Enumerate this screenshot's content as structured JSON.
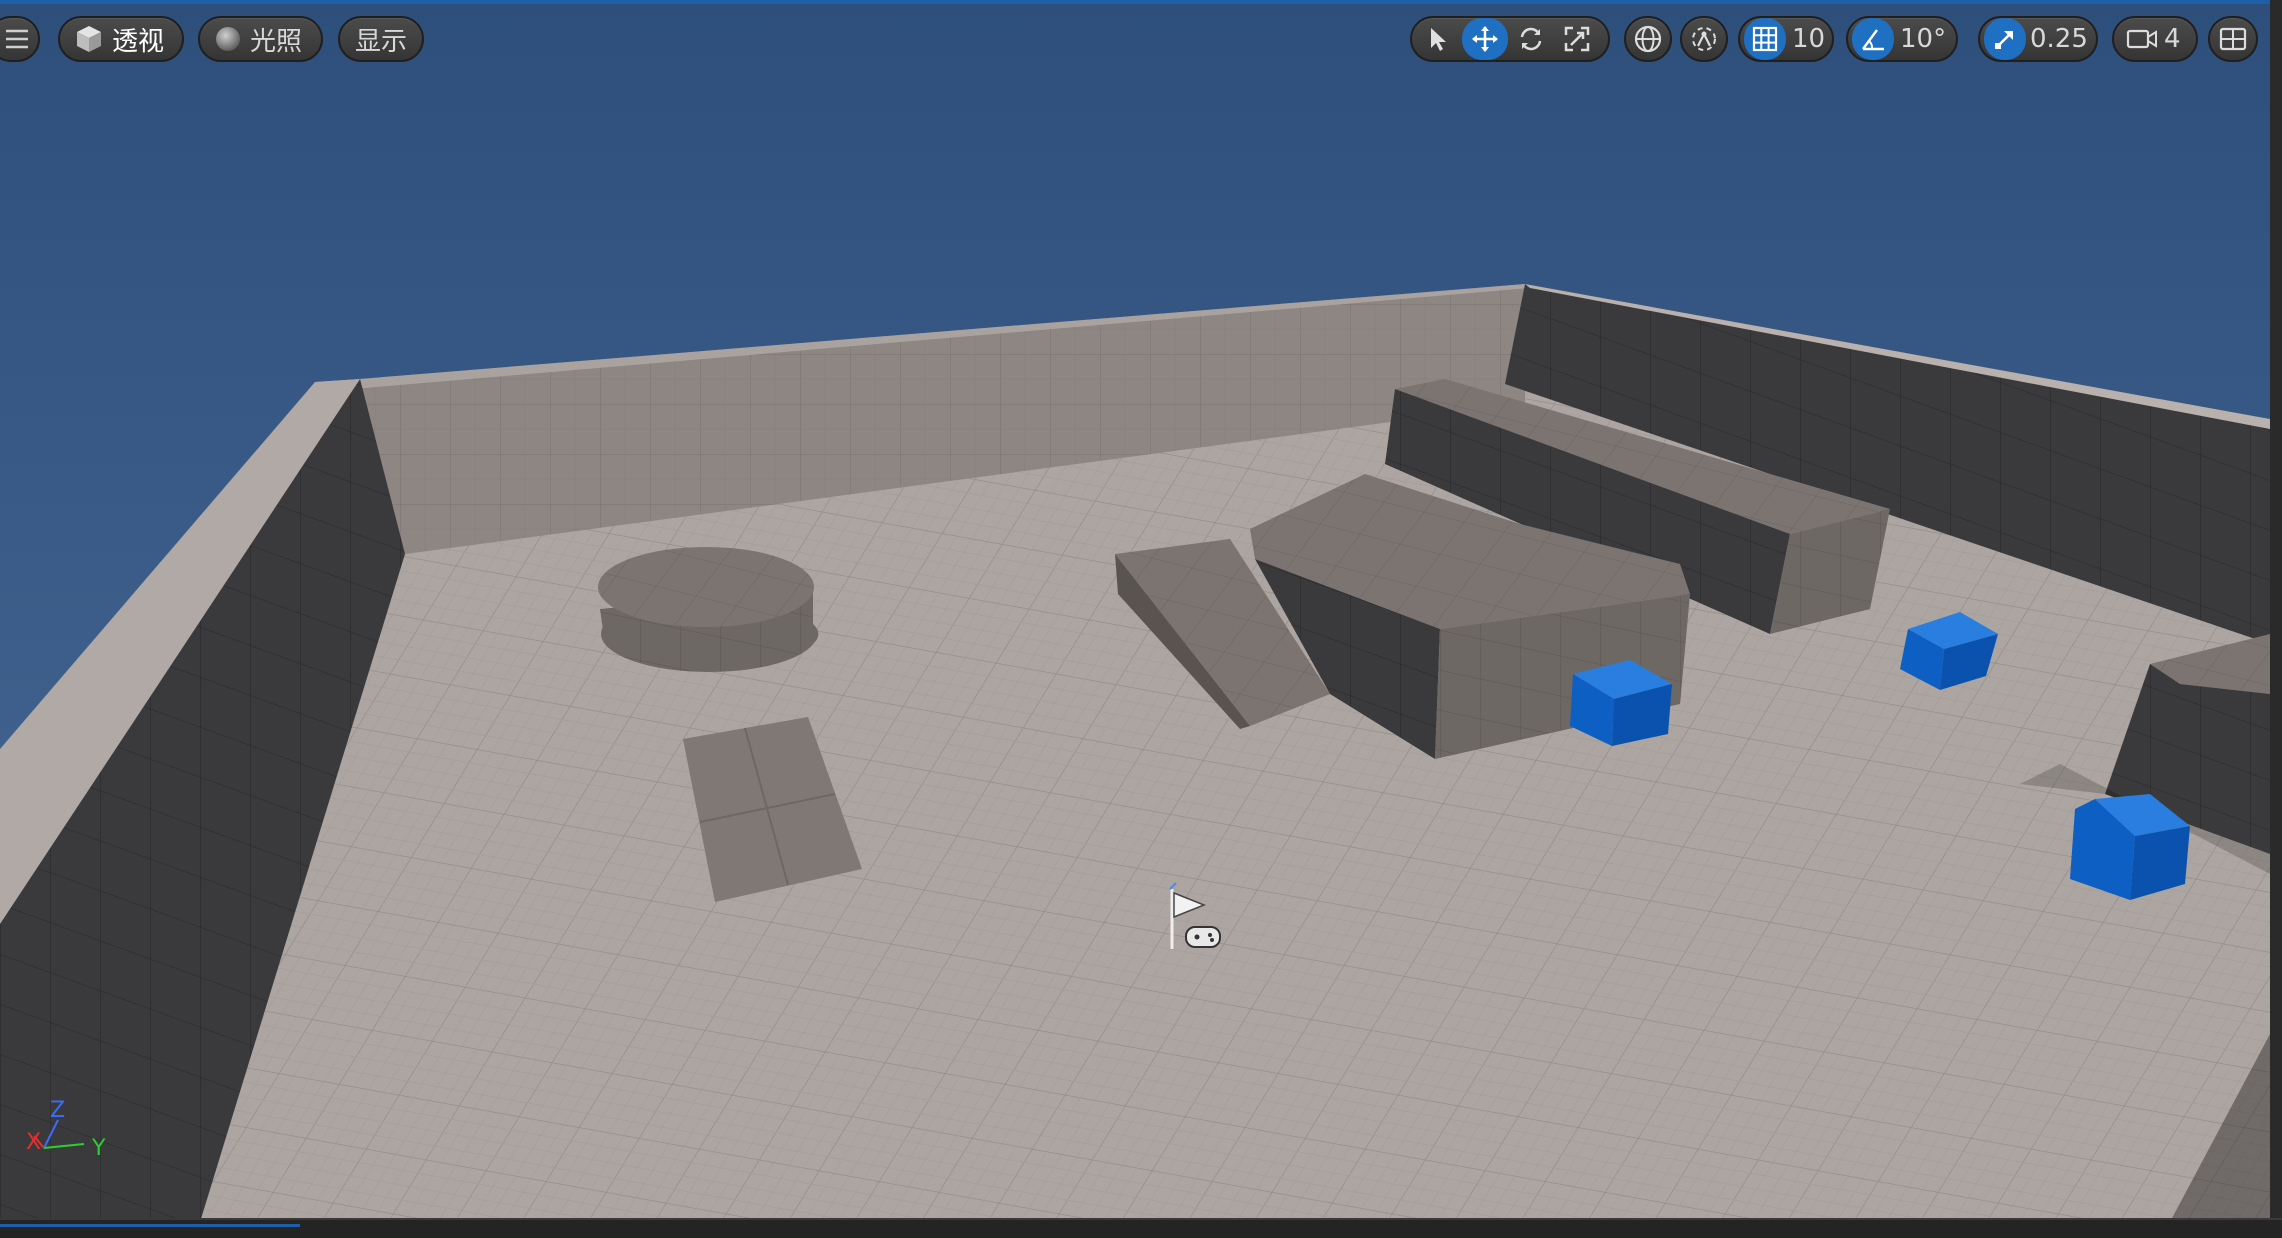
{
  "toolbar": {
    "menu_icon": "hamburger-menu-icon",
    "view_mode": {
      "icon": "cube-icon",
      "label": "透视"
    },
    "lighting": {
      "icon": "sphere-icon",
      "label": "光照"
    },
    "show": {
      "label": "显示"
    },
    "transform_tools": [
      "select-arrow-icon",
      "move-icon",
      "rotate-icon",
      "scale-icon"
    ],
    "world_local_icon": "globe-icon",
    "surface_snap_icon": "surface-snap-icon",
    "grid_snap": {
      "icon": "grid-icon",
      "value": "10"
    },
    "rotation_snap": {
      "icon": "angle-icon",
      "value": "10°"
    },
    "scale_snap": {
      "icon": "scale-arrow-icon",
      "value": "0.25"
    },
    "camera_speed": {
      "icon": "camera-icon",
      "value": "4"
    },
    "layout_icon": "viewport-layout-icon"
  },
  "axis_indicator": {
    "x": "X",
    "y": "Y",
    "z": "Z"
  },
  "scene_actor": {
    "icon": "player-start-icon"
  },
  "colors": {
    "sky": "#3e5f8e",
    "floor": "#aba39f",
    "accent": "#1f6fc2",
    "cube": "#0d63c9"
  }
}
